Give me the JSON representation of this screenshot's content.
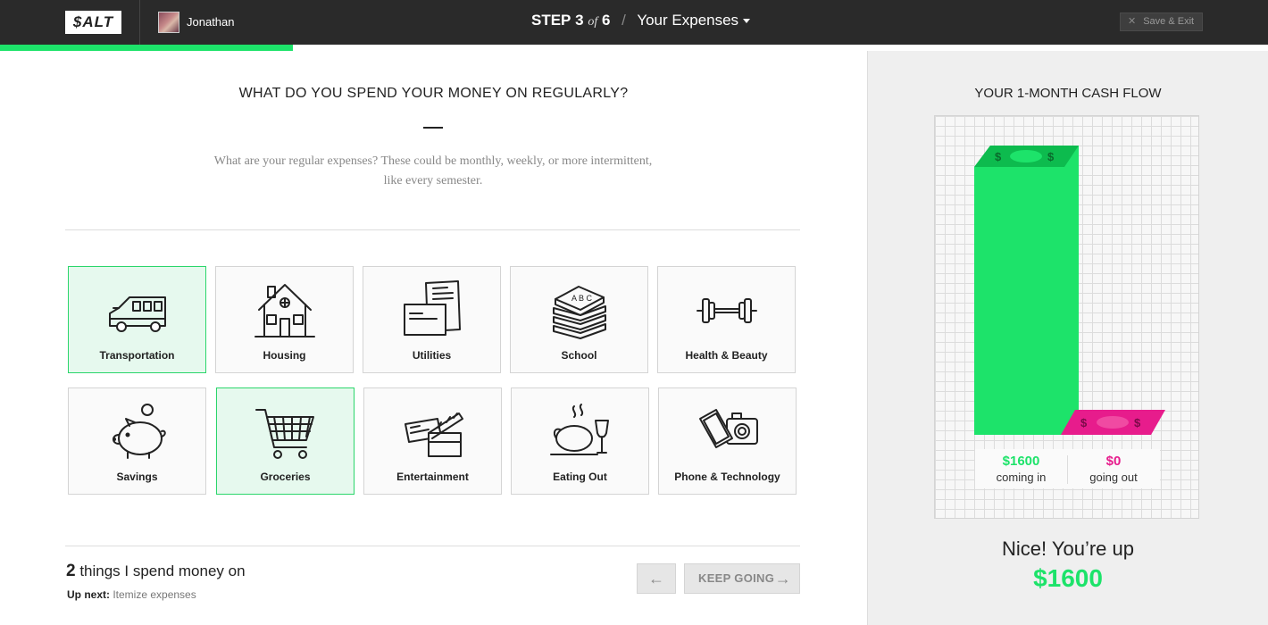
{
  "header": {
    "logo": "$ALT",
    "user_name": "Jonathan",
    "step_label": "STEP",
    "step_current": "3",
    "step_of": "of",
    "step_total": "6",
    "section_title": "Your Expenses",
    "save_exit": "Save & Exit",
    "progress_fraction": 0.5
  },
  "main": {
    "question": "WHAT DO YOU SPEND YOUR MONEY ON REGULARLY?",
    "subtitle": "What are your regular expenses? These could be monthly, weekly, or more intermittent, like every semester.",
    "categories": [
      {
        "label": "Transportation",
        "icon": "bus-icon",
        "selected": true
      },
      {
        "label": "Housing",
        "icon": "house-icon",
        "selected": false
      },
      {
        "label": "Utilities",
        "icon": "bills-icon",
        "selected": false
      },
      {
        "label": "School",
        "icon": "books-icon",
        "selected": false
      },
      {
        "label": "Health & Beauty",
        "icon": "dumbbell-icon",
        "selected": false
      },
      {
        "label": "Savings",
        "icon": "piggy-bank-icon",
        "selected": false
      },
      {
        "label": "Groceries",
        "icon": "shopping-cart-icon",
        "selected": true
      },
      {
        "label": "Entertainment",
        "icon": "tickets-clapper-icon",
        "selected": false
      },
      {
        "label": "Eating Out",
        "icon": "turkey-wine-icon",
        "selected": false
      },
      {
        "label": "Phone & Technology",
        "icon": "phone-camera-icon",
        "selected": false
      }
    ],
    "count": "2",
    "count_text": "things I spend money on",
    "up_next_label": "Up next:",
    "up_next_value": "Itemize expenses",
    "back_arrow": "←",
    "keep_going": "KEEP GOING",
    "keep_going_arrow": "→"
  },
  "cashflow": {
    "title": "YOUR 1-MONTH CASH FLOW",
    "coming_in_value": "$1600",
    "coming_in_label": "coming in",
    "going_out_value": "$0",
    "going_out_label": "going out",
    "summary": "Nice! You’re up",
    "summary_amount": "$1600",
    "in_color": "#1de36a",
    "out_color": "#e71c8c"
  }
}
